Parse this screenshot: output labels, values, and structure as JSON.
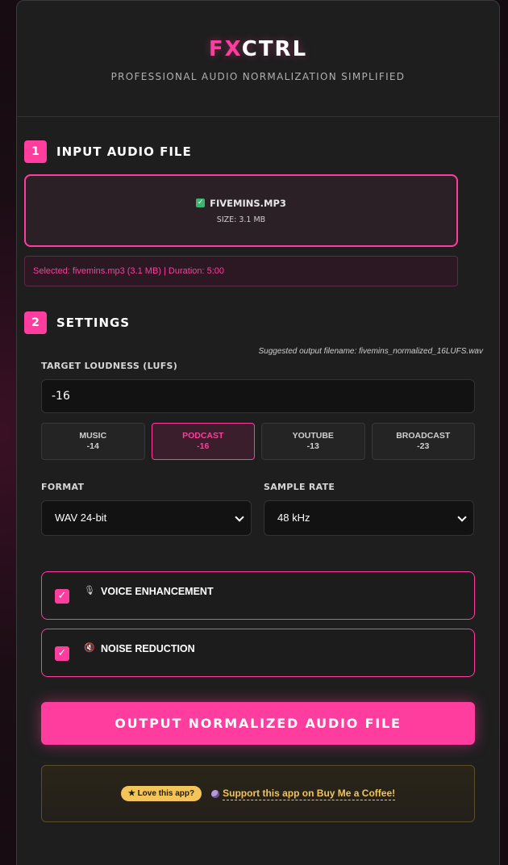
{
  "header": {
    "logo_fx": "FX",
    "logo_ctrl": "CTRL",
    "tagline": "PROFESSIONAL AUDIO NORMALIZATION SIMPLIFIED"
  },
  "input_section": {
    "number": "1",
    "title": "INPUT AUDIO FILE",
    "file_name": "FIVEMINS.MP3",
    "file_size": "SIZE: 3.1 MB",
    "selected_info": "Selected: fivemins.mp3 (3.1 MB) | Duration: 5:00"
  },
  "settings_section": {
    "number": "2",
    "title": "SETTINGS",
    "suggested_filename": "Suggested output filename: fivemins_normalized_16LUFS.wav",
    "target_label": "TARGET LOUDNESS (LUFS)",
    "target_value": "-16",
    "presets": [
      {
        "name": "MUSIC",
        "value": "-14",
        "active": false
      },
      {
        "name": "PODCAST",
        "value": "-16",
        "active": true
      },
      {
        "name": "YOUTUBE",
        "value": "-13",
        "active": false
      },
      {
        "name": "BROADCAST",
        "value": "-23",
        "active": false
      }
    ],
    "format_label": "FORMAT",
    "format_value": "WAV 24-bit",
    "sample_rate_label": "SAMPLE RATE",
    "sample_rate_value": "48 kHz",
    "voice_enhancement": {
      "label": "VOICE ENHANCEMENT",
      "checked": true,
      "icon": "microphone-icon"
    },
    "noise_reduction": {
      "label": "NOISE REDUCTION",
      "checked": true,
      "icon": "speaker-muted-icon"
    }
  },
  "cta_label": "OUTPUT NORMALIZED AUDIO FILE",
  "support": {
    "badge": "★ Love this app?",
    "link_text": "Support this app on Buy Me a Coffee!"
  },
  "colors": {
    "accent": "#ff3d9e",
    "background": "#1e1e1e",
    "gold": "#f2c45a"
  }
}
